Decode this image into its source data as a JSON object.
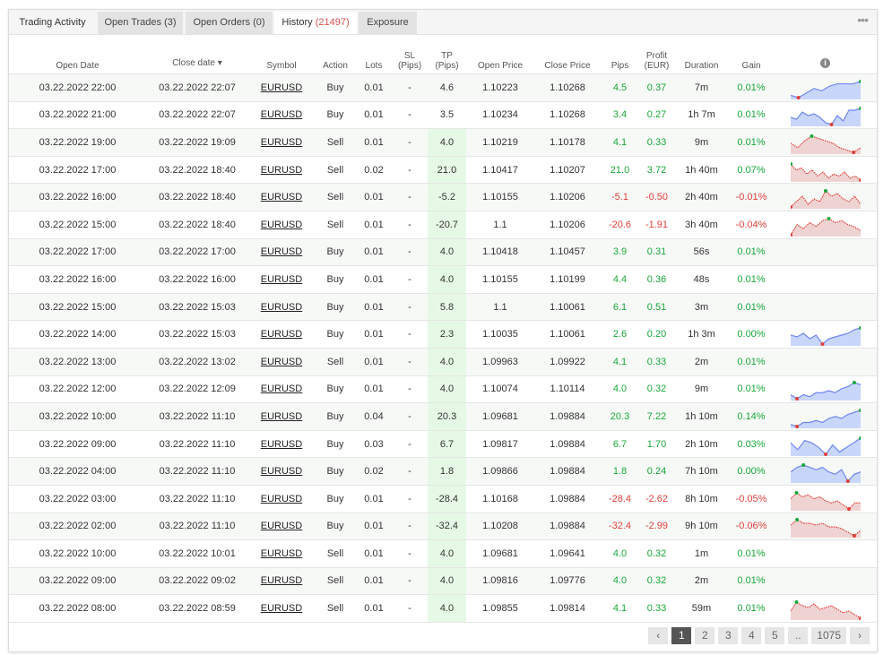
{
  "tabs": [
    {
      "label": "Trading Activity",
      "count": ""
    },
    {
      "label": "Open Trades",
      "count": "(3)"
    },
    {
      "label": "Open Orders",
      "count": "(0)"
    },
    {
      "label": "History",
      "count": "(21497)",
      "active": true
    },
    {
      "label": "Exposure",
      "count": ""
    }
  ],
  "columns": {
    "open_date": "Open Date",
    "close_date": "Close date ▾",
    "symbol": "Symbol",
    "action": "Action",
    "lots": "Lots",
    "sl": "SL",
    "sl_unit": "(Pips)",
    "tp": "TP",
    "tp_unit": "(Pips)",
    "open_price": "Open Price",
    "close_price": "Close Price",
    "pips": "Pips",
    "profit": "Profit",
    "profit_unit": "(EUR)",
    "duration": "Duration",
    "gain": "Gain",
    "info": "i"
  },
  "colors": {
    "positive": "#1aa83a",
    "negative": "#e0413a",
    "spark_blue": "#6f86f0",
    "spark_blue_fill": "#c9d6fb",
    "spark_red": "#e0413a",
    "spark_red_fill": "#efd3d3"
  },
  "rows": [
    {
      "open": "03.22.2022 22:00",
      "close": "03.22.2022 22:07",
      "symbol": "EURUSD",
      "action": "Buy",
      "lots": "0.01",
      "sl": "-",
      "tp": "4.6",
      "op": "1.10223",
      "cp": "1.10268",
      "pips": "4.5",
      "profit": "0.37",
      "dur": "7m",
      "gain": "0.01%",
      "neg": false,
      "spark": [
        2,
        1,
        3,
        5,
        4,
        6,
        7,
        7,
        7,
        8
      ]
    },
    {
      "open": "03.22.2022 21:00",
      "close": "03.22.2022 22:07",
      "symbol": "EURUSD",
      "action": "Buy",
      "lots": "0.01",
      "sl": "-",
      "tp": "3.5",
      "op": "1.10234",
      "cp": "1.10268",
      "pips": "3.4",
      "profit": "0.27",
      "dur": "1h 7m",
      "gain": "0.01%",
      "neg": false,
      "spark": [
        4,
        3,
        7,
        5,
        6,
        4,
        1,
        0,
        5,
        2,
        8,
        8,
        9
      ]
    },
    {
      "open": "03.22.2022 19:00",
      "close": "03.22.2022 19:09",
      "symbol": "EURUSD",
      "action": "Sell",
      "lots": "0.01",
      "sl": "-",
      "tp": "4.0",
      "op": "1.10219",
      "cp": "1.10178",
      "pips": "4.1",
      "profit": "0.33",
      "dur": "9m",
      "gain": "0.01%",
      "neg": false,
      "spark": [
        5,
        3,
        6,
        8,
        7,
        6,
        5,
        3,
        2,
        1,
        3
      ]
    },
    {
      "open": "03.22.2022 17:00",
      "close": "03.22.2022 18:40",
      "symbol": "EURUSD",
      "action": "Sell",
      "lots": "0.02",
      "sl": "-",
      "tp": "21.0",
      "op": "1.10417",
      "cp": "1.10207",
      "pips": "21.0",
      "profit": "3.72",
      "dur": "1h 40m",
      "gain": "0.07%",
      "neg": false,
      "spark": [
        9,
        6,
        7,
        4,
        6,
        3,
        5,
        2,
        4,
        3,
        5,
        2,
        3,
        1
      ]
    },
    {
      "open": "03.22.2022 16:00",
      "close": "03.22.2022 18:40",
      "symbol": "EURUSD",
      "action": "Sell",
      "lots": "0.01",
      "sl": "-",
      "tp": "-5.2",
      "op": "1.10155",
      "cp": "1.10206",
      "pips": "-5.1",
      "profit": "-0.50",
      "dur": "2h 40m",
      "gain": "-0.01%",
      "neg": true,
      "spark": [
        2,
        4,
        6,
        3,
        5,
        4,
        8,
        6,
        7,
        5,
        4,
        6,
        3
      ]
    },
    {
      "open": "03.22.2022 15:00",
      "close": "03.22.2022 18:40",
      "symbol": "EURUSD",
      "action": "Sell",
      "lots": "0.01",
      "sl": "-",
      "tp": "-20.7",
      "op": "1.1",
      "cp": "1.10206",
      "pips": "-20.6",
      "profit": "-1.91",
      "dur": "3h 40m",
      "gain": "-0.04%",
      "neg": true,
      "spark": [
        1,
        6,
        4,
        7,
        5,
        8,
        9,
        7,
        8,
        6,
        5,
        3
      ]
    },
    {
      "open": "03.22.2022 17:00",
      "close": "03.22.2022 17:00",
      "symbol": "EURUSD",
      "action": "Buy",
      "lots": "0.01",
      "sl": "-",
      "tp": "4.0",
      "op": "1.10418",
      "cp": "1.10457",
      "pips": "3.9",
      "profit": "0.31",
      "dur": "56s",
      "gain": "0.01%",
      "neg": false,
      "spark": []
    },
    {
      "open": "03.22.2022 16:00",
      "close": "03.22.2022 16:00",
      "symbol": "EURUSD",
      "action": "Buy",
      "lots": "0.01",
      "sl": "-",
      "tp": "4.0",
      "op": "1.10155",
      "cp": "1.10199",
      "pips": "4.4",
      "profit": "0.36",
      "dur": "48s",
      "gain": "0.01%",
      "neg": false,
      "spark": []
    },
    {
      "open": "03.22.2022 15:00",
      "close": "03.22.2022 15:03",
      "symbol": "EURUSD",
      "action": "Buy",
      "lots": "0.01",
      "sl": "-",
      "tp": "5.8",
      "op": "1.1",
      "cp": "1.10061",
      "pips": "6.1",
      "profit": "0.51",
      "dur": "3m",
      "gain": "0.01%",
      "neg": false,
      "spark": []
    },
    {
      "open": "03.22.2022 14:00",
      "close": "03.22.2022 15:03",
      "symbol": "EURUSD",
      "action": "Buy",
      "lots": "0.01",
      "sl": "-",
      "tp": "2.3",
      "op": "1.10035",
      "cp": "1.10061",
      "pips": "2.6",
      "profit": "0.20",
      "dur": "1h 3m",
      "gain": "0.00%",
      "neg": false,
      "spark": [
        5,
        4,
        6,
        3,
        5,
        0,
        3,
        4,
        5,
        6,
        8,
        9
      ]
    },
    {
      "open": "03.22.2022 13:00",
      "close": "03.22.2022 13:02",
      "symbol": "EURUSD",
      "action": "Sell",
      "lots": "0.01",
      "sl": "-",
      "tp": "4.0",
      "op": "1.09963",
      "cp": "1.09922",
      "pips": "4.1",
      "profit": "0.33",
      "dur": "2m",
      "gain": "0.01%",
      "neg": false,
      "spark": []
    },
    {
      "open": "03.22.2022 12:00",
      "close": "03.22.2022 12:09",
      "symbol": "EURUSD",
      "action": "Buy",
      "lots": "0.01",
      "sl": "-",
      "tp": "4.0",
      "op": "1.10074",
      "cp": "1.10114",
      "pips": "4.0",
      "profit": "0.32",
      "dur": "9m",
      "gain": "0.01%",
      "neg": false,
      "spark": [
        3,
        1,
        3,
        2,
        4,
        4,
        5,
        4,
        6,
        7,
        9,
        8
      ]
    },
    {
      "open": "03.22.2022 10:00",
      "close": "03.22.2022 11:10",
      "symbol": "EURUSD",
      "action": "Buy",
      "lots": "0.04",
      "sl": "-",
      "tp": "20.3",
      "op": "1.09681",
      "cp": "1.09884",
      "pips": "20.3",
      "profit": "7.22",
      "dur": "1h 10m",
      "gain": "0.14%",
      "neg": false,
      "spark": [
        2,
        1,
        3,
        3,
        4,
        3,
        5,
        6,
        5,
        7,
        8,
        9
      ]
    },
    {
      "open": "03.22.2022 09:00",
      "close": "03.22.2022 11:10",
      "symbol": "EURUSD",
      "action": "Buy",
      "lots": "0.03",
      "sl": "-",
      "tp": "6.7",
      "op": "1.09817",
      "cp": "1.09884",
      "pips": "6.7",
      "profit": "1.70",
      "dur": "2h 10m",
      "gain": "0.03%",
      "neg": false,
      "spark": [
        7,
        4,
        8,
        7,
        5,
        2,
        6,
        3,
        5,
        7,
        9
      ]
    },
    {
      "open": "03.22.2022 04:00",
      "close": "03.22.2022 11:10",
      "symbol": "EURUSD",
      "action": "Buy",
      "lots": "0.02",
      "sl": "-",
      "tp": "1.8",
      "op": "1.09866",
      "cp": "1.09884",
      "pips": "1.8",
      "profit": "0.24",
      "dur": "7h 10m",
      "gain": "0.00%",
      "neg": false,
      "spark": [
        6,
        8,
        9,
        8,
        7,
        8,
        6,
        5,
        7,
        2,
        5,
        6
      ]
    },
    {
      "open": "03.22.2022 03:00",
      "close": "03.22.2022 11:10",
      "symbol": "EURUSD",
      "action": "Buy",
      "lots": "0.01",
      "sl": "-",
      "tp": "-28.4",
      "op": "1.10168",
      "cp": "1.09884",
      "pips": "-28.4",
      "profit": "-2.62",
      "dur": "8h 10m",
      "gain": "-0.05%",
      "neg": true,
      "spark": [
        6,
        9,
        7,
        8,
        6,
        7,
        5,
        4,
        5,
        3,
        1,
        4,
        4
      ]
    },
    {
      "open": "03.22.2022 02:00",
      "close": "03.22.2022 11:10",
      "symbol": "EURUSD",
      "action": "Buy",
      "lots": "0.01",
      "sl": "-",
      "tp": "-32.4",
      "op": "1.10208",
      "cp": "1.09884",
      "pips": "-32.4",
      "profit": "-2.99",
      "dur": "9h 10m",
      "gain": "-0.06%",
      "neg": true,
      "spark": [
        6,
        9,
        7,
        7,
        6,
        7,
        5,
        5,
        4,
        2,
        0,
        3
      ]
    },
    {
      "open": "03.22.2022 10:00",
      "close": "03.22.2022 10:01",
      "symbol": "EURUSD",
      "action": "Sell",
      "lots": "0.01",
      "sl": "-",
      "tp": "4.0",
      "op": "1.09681",
      "cp": "1.09641",
      "pips": "4.0",
      "profit": "0.32",
      "dur": "1m",
      "gain": "0.01%",
      "neg": false,
      "spark": []
    },
    {
      "open": "03.22.2022 09:00",
      "close": "03.22.2022 09:02",
      "symbol": "EURUSD",
      "action": "Sell",
      "lots": "0.01",
      "sl": "-",
      "tp": "4.0",
      "op": "1.09816",
      "cp": "1.09776",
      "pips": "4.0",
      "profit": "0.32",
      "dur": "2m",
      "gain": "0.01%",
      "neg": false,
      "spark": []
    },
    {
      "open": "03.22.2022 08:00",
      "close": "03.22.2022 08:59",
      "symbol": "EURUSD",
      "action": "Sell",
      "lots": "0.01",
      "sl": "-",
      "tp": "4.0",
      "op": "1.09855",
      "cp": "1.09814",
      "pips": "4.1",
      "profit": "0.33",
      "dur": "59m",
      "gain": "0.01%",
      "neg": false,
      "spark": [
        4,
        9,
        7,
        6,
        8,
        5,
        6,
        7,
        5,
        3,
        4,
        2,
        0
      ]
    }
  ],
  "pagination": {
    "prev": "‹",
    "pages": [
      "1",
      "2",
      "3",
      "4",
      "5"
    ],
    "ellipsis": "..",
    "last": "1075",
    "next": "›",
    "current": "1"
  }
}
